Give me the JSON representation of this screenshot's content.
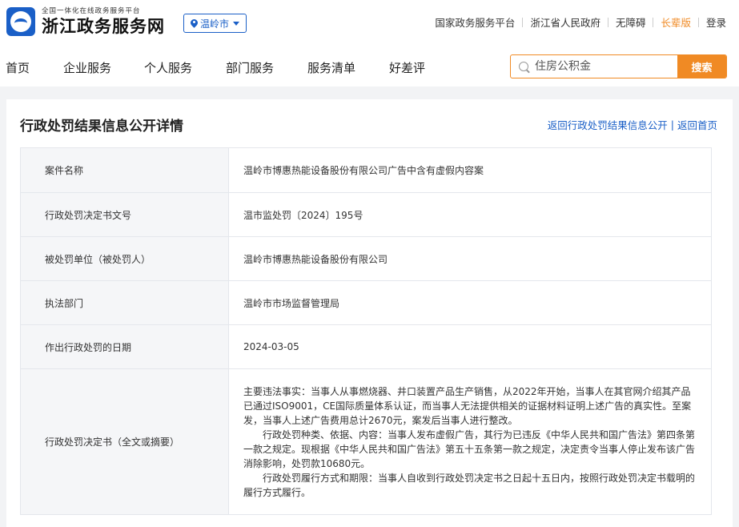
{
  "header": {
    "logo_small": "全国一体化在线政务服务平台",
    "logo_big": "浙江政务服务网",
    "city": "温岭市",
    "links": [
      "国家政务服务平台",
      "浙江省人民政府",
      "无障碍",
      "长辈版",
      "登录"
    ]
  },
  "nav": {
    "items": [
      "首页",
      "企业服务",
      "个人服务",
      "部门服务",
      "服务清单",
      "好差评"
    ],
    "search_placeholder": "住房公积金",
    "search_button": "搜索"
  },
  "detail": {
    "title": "行政处罚结果信息公开详情",
    "back_list": "返回行政处罚结果信息公开",
    "separator": "|",
    "back_home": "返回首页",
    "rows": [
      {
        "label": "案件名称",
        "value": "温岭市博惠热能设备股份有限公司广告中含有虚假内容案"
      },
      {
        "label": "行政处罚决定书文号",
        "value": "温市监处罚〔2024〕195号"
      },
      {
        "label": "被处罚单位（被处罚人）",
        "value": "温岭市博惠热能设备股份有限公司"
      },
      {
        "label": "执法部门",
        "value": "温岭市市场监督管理局"
      },
      {
        "label": "作出行政处罚的日期",
        "value": "2024-03-05"
      }
    ],
    "decision_label": "行政处罚决定书（全文或摘要）",
    "decision_paragraphs": [
      "主要违法事实：当事人从事燃烧器、井口装置产品生产销售，从2022年开始，当事人在其官网介绍其产品已通过ISO9001，CE国际质量体系认证，而当事人无法提供相关的证据材料证明上述广告的真实性。至案发，当事人上述广告费用总计2670元，案发后当事人进行整改。",
      "行政处罚种类、依据、内容：当事人发布虚假广告，其行为已违反《中华人民共和国广告法》第四条第一款之规定。现根据《中华人民共和国广告法》第五十五条第一款之规定，决定责令当事人停止发布该广告消除影响，处罚款10680元。",
      "行政处罚履行方式和期限：当事人自收到行政处罚决定书之日起十五日内，按照行政处罚决定书载明的履行方式履行。"
    ]
  },
  "colors": {
    "brand_blue": "#1a5fc7",
    "accent_orange": "#f08a24"
  }
}
